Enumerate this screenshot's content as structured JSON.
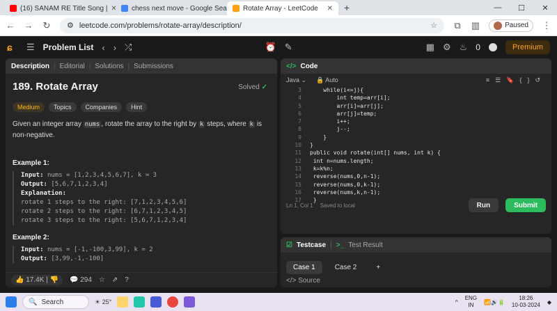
{
  "browser": {
    "tabs": [
      {
        "title": "(16) SANAM RE Title Song |",
        "color": "#ff0000"
      },
      {
        "title": "chess next move - Google Sea",
        "color": "#4285f4"
      },
      {
        "title": "Rotate Array - LeetCode",
        "color": "#ffa116"
      }
    ],
    "url": "leetcode.com/problems/rotate-array/description/",
    "profile_status": "Paused"
  },
  "topbar": {
    "problem_list": "Problem List",
    "fire_count": "0",
    "premium": "Premium"
  },
  "left_tabs": [
    "Description",
    "Editorial",
    "Solutions",
    "Submissions"
  ],
  "problem": {
    "title": "189. Rotate Array",
    "status": "Solved",
    "difficulty": "Medium",
    "chips": [
      "Topics",
      "Companies",
      "Hint"
    ],
    "statement_1": "Given an integer array ",
    "statement_code1": "nums",
    "statement_2": ", rotate the array to the right by ",
    "statement_code2": "k",
    "statement_3": " steps, where ",
    "statement_code3": "k",
    "statement_4": " is non-negative.",
    "ex1_heading": "Example 1:",
    "ex1_input_label": "Input:",
    "ex1_input": "nums = [1,2,3,4,5,6,7], k = 3",
    "ex1_output_label": "Output:",
    "ex1_output": "[5,6,7,1,2,3,4]",
    "ex1_expl_label": "Explanation:",
    "ex1_lines": [
      "rotate 1 steps to the right: [7,1,2,3,4,5,6]",
      "rotate 2 steps to the right: [6,7,1,2,3,4,5]",
      "rotate 3 steps to the right: [5,6,7,1,2,3,4]"
    ],
    "ex2_heading": "Example 2:",
    "ex2_input_label": "Input:",
    "ex2_input": "nums = [-1,-100,3,99], k = 2",
    "ex2_output_label": "Output:",
    "ex2_output": "[3,99,-1,-100]"
  },
  "footer": {
    "likes": "17.4K",
    "comments": "294"
  },
  "code_panel": {
    "title": "Code",
    "language": "Java",
    "mode": "Auto",
    "lines": [
      {
        "n": "3",
        "t": "    while(i<=j){"
      },
      {
        "n": "4",
        "t": "        int temp=arr[i];"
      },
      {
        "n": "5",
        "t": "        arr[i]=arr[j];"
      },
      {
        "n": "6",
        "t": "        arr[j]=temp;"
      },
      {
        "n": "7",
        "t": "        i++;"
      },
      {
        "n": "8",
        "t": "        j--;"
      },
      {
        "n": "9",
        "t": "    }"
      },
      {
        "n": "10",
        "t": "}"
      },
      {
        "n": "11",
        "t": "public void rotate(int[] nums, int k) {"
      },
      {
        "n": "12",
        "t": " int n=nums.length;"
      },
      {
        "n": "13",
        "t": " k=k%n;"
      },
      {
        "n": "14",
        "t": " reverse(nums,0,n-1);"
      },
      {
        "n": "15",
        "t": " reverse(nums,0,k-1);"
      },
      {
        "n": "16",
        "t": " reverse(nums,k,n-1);"
      },
      {
        "n": "17",
        "t": " }"
      }
    ],
    "cursor": "Ln 1, Col 1",
    "saved": "Saved to local",
    "run": "Run",
    "submit": "Submit"
  },
  "testcase": {
    "tab1": "Testcase",
    "tab2": "Test Result",
    "cases": [
      "Case 1",
      "Case 2"
    ],
    "source": "Source"
  },
  "taskbar": {
    "search": "Search",
    "weather": "25°",
    "lang1": "ENG",
    "lang2": "IN",
    "time": "18:26",
    "date": "10-03-2024"
  }
}
